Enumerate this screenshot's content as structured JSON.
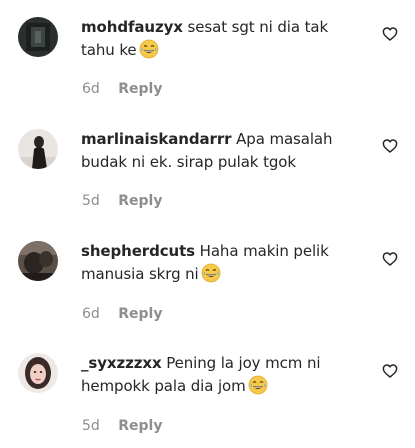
{
  "comments": [
    {
      "username": "mohdfauzyx",
      "text": "sesat sgt ni dia tak tahu ke",
      "emoji": "grinning-sweat-emoji",
      "time": "6d",
      "reply_label": "Reply"
    },
    {
      "username": "marlinaiskandarrr",
      "text": "Apa masalah budak ni ek. sirap pulak tgok",
      "emoji": null,
      "time": "5d",
      "reply_label": "Reply"
    },
    {
      "username": "shepherdcuts",
      "text": "Haha makin pelik manusia skrg ni",
      "emoji": "grinning-sweat-emoji",
      "time": "6d",
      "reply_label": "Reply"
    },
    {
      "username": "_syxzzzxx",
      "text": "Pening la joy mcm ni hempokk pala dia jom",
      "emoji": "grinning-sweat-emoji",
      "time": "5d",
      "reply_label": "Reply"
    }
  ],
  "colors": {
    "text": "#262626",
    "muted": "#8e8e8e",
    "background": "#ffffff"
  },
  "icons": {
    "like": "heart-outline-icon"
  }
}
